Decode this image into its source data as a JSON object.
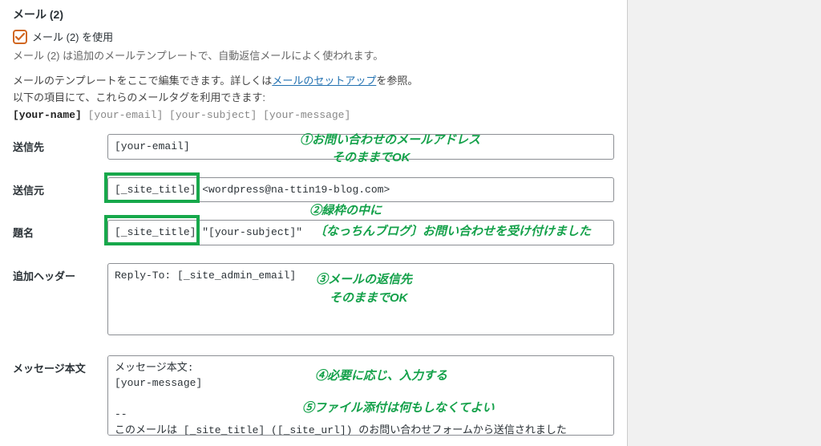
{
  "section": {
    "title": "メール (2)",
    "checkbox_label": "メール (2) を使用",
    "checkbox_checked": true,
    "desc": "メール (2) は追加のメールテンプレートで、自動返信メールによく使われます。",
    "intro_1a": "メールのテンプレートをここで編集できます。詳しくは",
    "intro_link": "メールのセットアップ",
    "intro_1b": "を参照。",
    "intro_2": "以下の項目にて、これらのメールタグを利用できます:",
    "tags_bold": "[your-name]",
    "tags_rest": " [your-email] [your-subject] [your-message]"
  },
  "fields": {
    "to": {
      "label": "送信先",
      "value": "[your-email]"
    },
    "from": {
      "label": "送信元",
      "value": "[_site_title] <wordpress@na-ttin19-blog.com>"
    },
    "subject": {
      "label": "題名",
      "value": "[_site_title] \"[your-subject]\""
    },
    "headers": {
      "label": "追加ヘッダー",
      "value": "Reply-To: [_site_admin_email]"
    },
    "body": {
      "label": "メッセージ本文",
      "value": "メッセージ本文:\n[your-message]\n\n-- \nこのメールは [_site_title] ([_site_url]) のお問い合わせフォームから送信されました"
    }
  },
  "annotations": {
    "a1_line1": "①お問い合わせのメールアドレス",
    "a1_line2": "そのままでOK",
    "a2_line1": "②緑枠の中に",
    "a2_line2": "〔なっちんブログ〕お問い合わせを受け付けました",
    "a3_line1": "③メールの返信先",
    "a3_line2": "そのままでOK",
    "a4": "④必要に応じ、入力する",
    "a5": "⑤ファイル添付は何もしなくてよい"
  },
  "colors": {
    "accent_green": "#17a84b",
    "accent_orange": "#d16721"
  }
}
